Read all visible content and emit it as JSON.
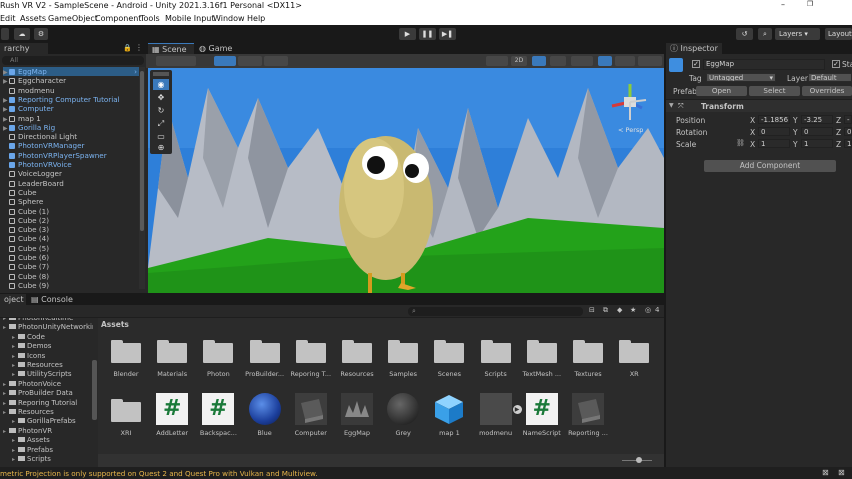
{
  "window": {
    "title": "Rush VR V2 - SampleScene - Android - Unity 2021.3.16f1 Personal <DX11>",
    "minimize": "–",
    "maximize": "❐",
    "close": "✕"
  },
  "menu": [
    "Edit",
    "Assets",
    "GameObject",
    "Component",
    "Tools",
    "Mobile Input",
    "Window",
    "Help"
  ],
  "toolbar": {
    "layers": "Layers",
    "layout": "Layout",
    "play_controls": [
      "play",
      "pause",
      "step"
    ]
  },
  "hierarchy": {
    "tab": "rarchy",
    "search_placeholder": "All",
    "items": [
      {
        "label": "EggMap",
        "icon": "prefab-icon",
        "blue": true,
        "arrow": "▶"
      },
      {
        "label": "Eggcharacter",
        "icon": "cube-icon",
        "blue": false,
        "arrow": "▶"
      },
      {
        "label": "modmenu",
        "icon": "cube-icon",
        "blue": false,
        "arrow": ""
      },
      {
        "label": "Reporting Computer Tutorial",
        "icon": "prefab-icon",
        "blue": true,
        "arrow": "▶"
      },
      {
        "label": "Computer",
        "icon": "prefab-icon",
        "blue": true,
        "arrow": "▶"
      },
      {
        "label": "map 1",
        "icon": "cube-icon",
        "blue": false,
        "arrow": "▶"
      },
      {
        "label": "Gorilla Rig",
        "icon": "prefab-icon",
        "blue": true,
        "arrow": "▶"
      },
      {
        "label": "Directional Light",
        "icon": "cube-icon",
        "blue": false,
        "arrow": ""
      },
      {
        "label": "PhotonVRManager",
        "icon": "prefab-icon",
        "blue": true,
        "arrow": ""
      },
      {
        "label": "PhotonVRPlayerSpawner",
        "icon": "prefab-icon",
        "blue": true,
        "arrow": ""
      },
      {
        "label": "PhotonVRVoice",
        "icon": "prefab-icon",
        "blue": true,
        "arrow": ""
      },
      {
        "label": "VoiceLogger",
        "icon": "cube-icon",
        "blue": false,
        "arrow": ""
      },
      {
        "label": "LeaderBoard",
        "icon": "cube-icon",
        "blue": false,
        "arrow": ""
      },
      {
        "label": "Cube",
        "icon": "cube-icon",
        "blue": false,
        "arrow": ""
      },
      {
        "label": "Sphere",
        "icon": "cube-icon",
        "blue": false,
        "arrow": ""
      },
      {
        "label": "Cube (1)",
        "icon": "cube-icon",
        "blue": false,
        "arrow": ""
      },
      {
        "label": "Cube (2)",
        "icon": "cube-icon",
        "blue": false,
        "arrow": ""
      },
      {
        "label": "Cube (3)",
        "icon": "cube-icon",
        "blue": false,
        "arrow": ""
      },
      {
        "label": "Cube (4)",
        "icon": "cube-icon",
        "blue": false,
        "arrow": ""
      },
      {
        "label": "Cube (5)",
        "icon": "cube-icon",
        "blue": false,
        "arrow": ""
      },
      {
        "label": "Cube (6)",
        "icon": "cube-icon",
        "blue": false,
        "arrow": ""
      },
      {
        "label": "Cube (7)",
        "icon": "cube-icon",
        "blue": false,
        "arrow": ""
      },
      {
        "label": "Cube (8)",
        "icon": "cube-icon",
        "blue": false,
        "arrow": ""
      },
      {
        "label": "Cube (9)",
        "icon": "cube-icon",
        "blue": false,
        "arrow": ""
      }
    ]
  },
  "scene": {
    "tabs": [
      "Scene",
      "Game"
    ],
    "mode_2d": "2D",
    "gizmo_label": "< Persp"
  },
  "inspector": {
    "tab": "Inspector",
    "object_name": "EggMap",
    "static_label": "Sta",
    "tag_label": "Tag",
    "tag_value": "Untagged",
    "layer_label": "Layer",
    "layer_value": "Default",
    "prefab_label": "Prefab",
    "prefab_open": "Open",
    "prefab_select": "Select",
    "prefab_overrides": "Overrides",
    "transform_title": "Transform",
    "position_label": "Position",
    "rotation_label": "Rotation",
    "scale_label": "Scale",
    "position": {
      "x": "-1.1856",
      "y": "-3.25",
      "z": "-"
    },
    "rotation": {
      "x": "0",
      "y": "0",
      "z": "0"
    },
    "scale": {
      "x": "1",
      "y": "1",
      "z": "1"
    },
    "axis_x": "X",
    "axis_y": "Y",
    "axis_z": "Z",
    "add_component": "Add Component"
  },
  "project": {
    "tabs": [
      "oject",
      "Console"
    ],
    "badge": "4",
    "breadcrumb": "Assets",
    "folders_tree": [
      {
        "label": "PhotonRealtime",
        "indent": 0
      },
      {
        "label": "PhotonUnityNetworkin",
        "indent": 0
      },
      {
        "label": "Code",
        "indent": 1
      },
      {
        "label": "Demos",
        "indent": 1
      },
      {
        "label": "Icons",
        "indent": 1
      },
      {
        "label": "Resources",
        "indent": 1
      },
      {
        "label": "UtilityScripts",
        "indent": 1
      },
      {
        "label": "PhotonVoice",
        "indent": 0
      },
      {
        "label": "ProBuilder Data",
        "indent": 0
      },
      {
        "label": "Reporing Tutorial",
        "indent": 0
      },
      {
        "label": "Resources",
        "indent": 0
      },
      {
        "label": "GorillaPrefabs",
        "indent": 1
      },
      {
        "label": "PhotonVR",
        "indent": 0
      },
      {
        "label": "Assets",
        "indent": 1
      },
      {
        "label": "Prefabs",
        "indent": 1
      },
      {
        "label": "Scripts",
        "indent": 1
      }
    ],
    "assets_row1": [
      "Blender",
      "Materials",
      "Photon",
      "ProBuilder...",
      "Reporing T...",
      "Resources",
      "Samples",
      "Scenes",
      "Scripts",
      "TextMesh ...",
      "Textures",
      "XR"
    ],
    "assets_row2": [
      {
        "label": "XRI",
        "kind": "folder"
      },
      {
        "label": "AddLetter",
        "kind": "script"
      },
      {
        "label": "Backspac...",
        "kind": "script"
      },
      {
        "label": "Blue",
        "kind": "material-blue"
      },
      {
        "label": "Computer",
        "kind": "model"
      },
      {
        "label": "EggMap",
        "kind": "model-map"
      },
      {
        "label": "Grey",
        "kind": "material-grey"
      },
      {
        "label": "map 1",
        "kind": "cube-blue"
      },
      {
        "label": "modmenu",
        "kind": "prefab-dark"
      },
      {
        "label": "NameScript",
        "kind": "script"
      },
      {
        "label": "Reporting ...",
        "kind": "model"
      }
    ]
  },
  "status_bar": {
    "message": "metric Projection is only supported on Quest 2 and Quest Pro with Vulkan and Multiview."
  }
}
